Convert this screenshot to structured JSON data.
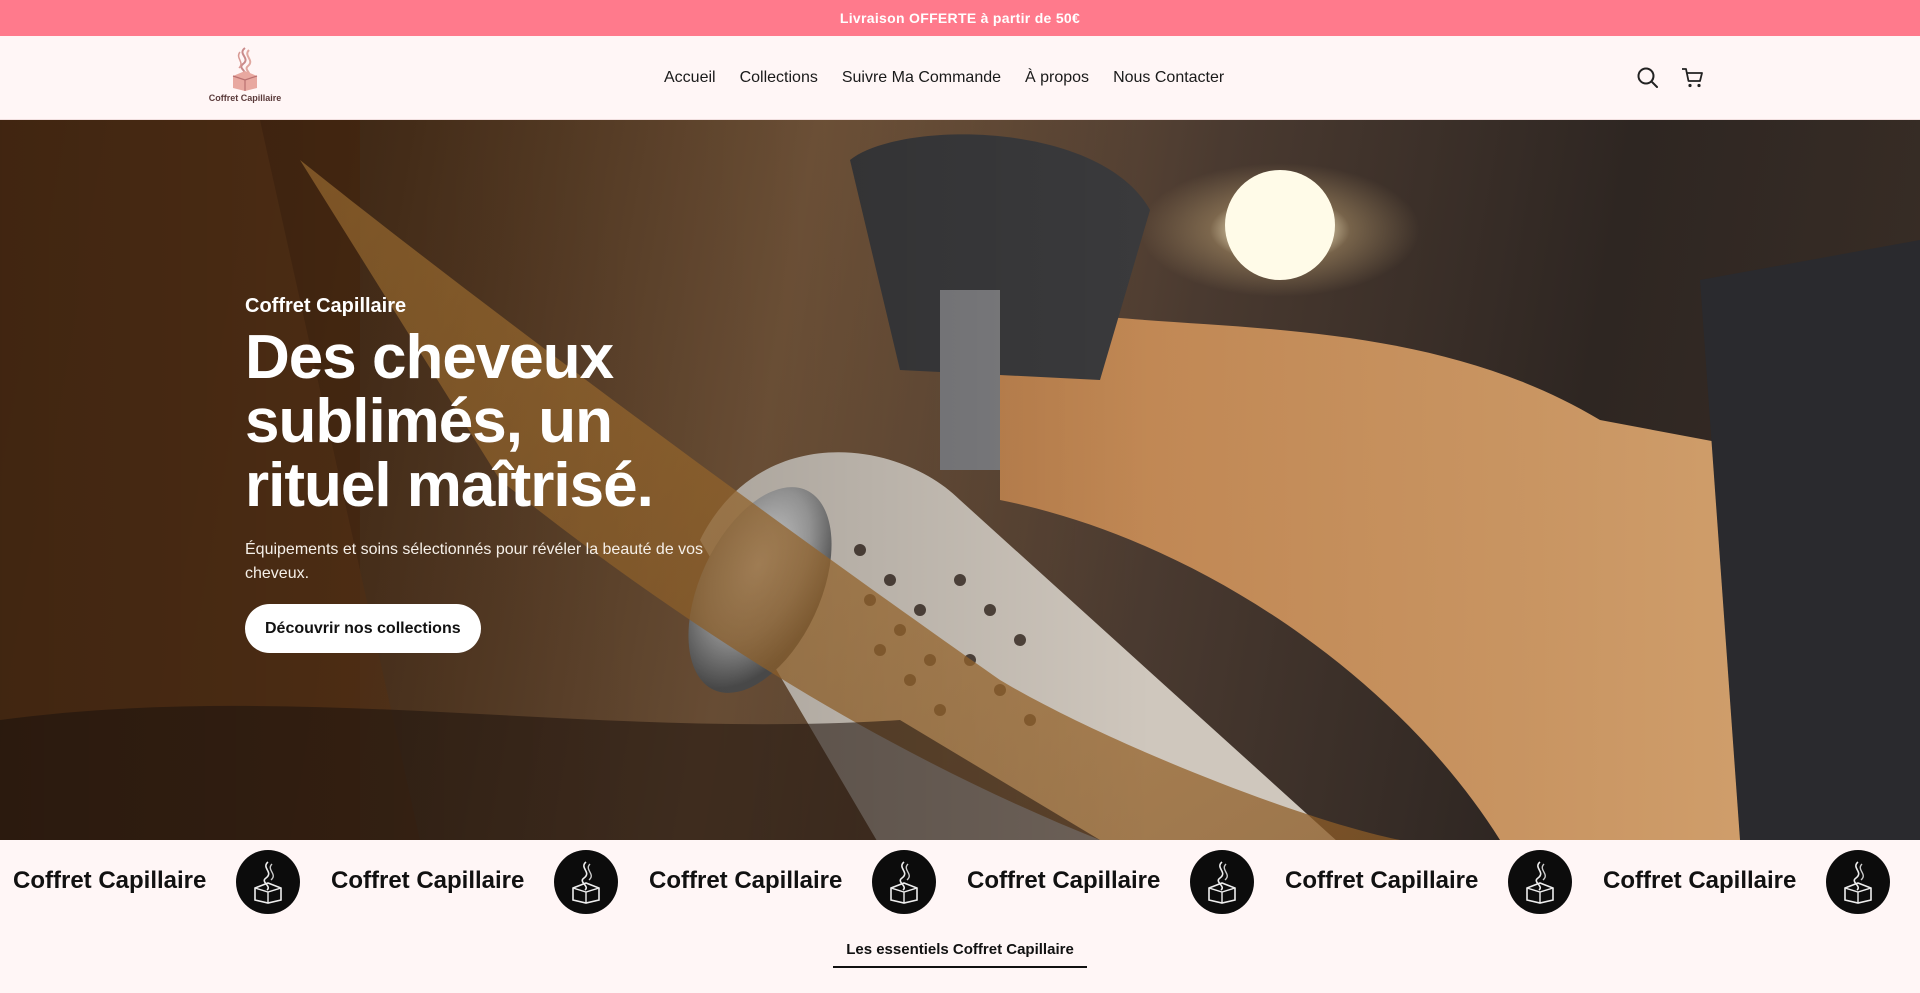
{
  "announcement": {
    "text": "Livraison OFFERTE à partir de 50€"
  },
  "header": {
    "logo_text": "Coffret Capillaire",
    "nav": [
      {
        "label": "Accueil"
      },
      {
        "label": "Collections"
      },
      {
        "label": "Suivre Ma Commande"
      },
      {
        "label": "À propos"
      },
      {
        "label": "Nous Contacter"
      }
    ],
    "icons": {
      "search": "search-icon",
      "cart": "cart-icon"
    }
  },
  "hero": {
    "subtitle": "Coffret Capillaire",
    "title": "Des cheveux sublimés, un rituel maîtrisé.",
    "description": "Équipements et soins sélectionnés pour révéler la beauté de vos cheveux.",
    "cta_label": "Découvrir nos collections"
  },
  "marquee": {
    "items": [
      {
        "text": "Coffret Capillaire"
      },
      {
        "text": "Coffret Capillaire"
      },
      {
        "text": "Coffret Capillaire"
      },
      {
        "text": "Coffret Capillaire"
      },
      {
        "text": "Coffret Capillaire"
      },
      {
        "text": "Coffret Capillaire"
      }
    ]
  },
  "section": {
    "tab_label": "Les essentiels Coffret Capillaire"
  },
  "colors": {
    "announcement_bg": "#ff7a8c",
    "page_bg": "#fff6f6",
    "text": "#1a1a1a"
  }
}
